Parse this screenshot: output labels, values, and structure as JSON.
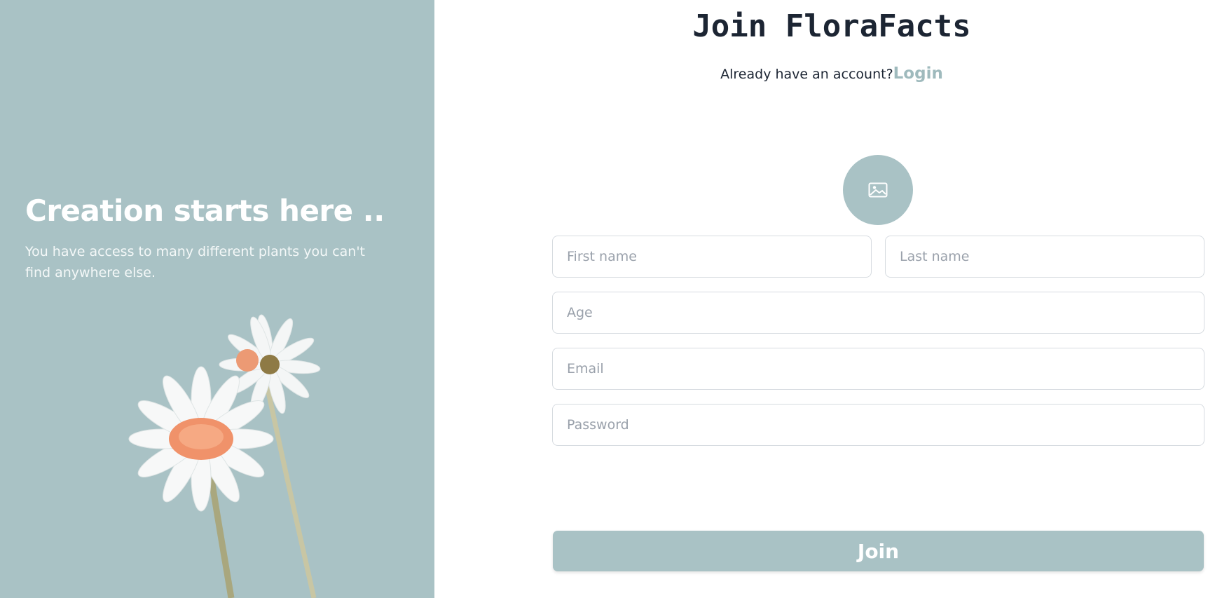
{
  "hero": {
    "title": "Creation starts here ..",
    "subtitle": "You have access to many different plants you can't find anywhere else."
  },
  "form": {
    "title": "Join FloraFacts",
    "login_prompt": "Already have an account?",
    "login_link": "Login",
    "avatar_icon": "image-icon",
    "first_name_placeholder": "First name",
    "last_name_placeholder": "Last name",
    "age_placeholder": "Age",
    "email_placeholder": "Email",
    "password_placeholder": "Password",
    "submit_label": "Join"
  },
  "colors": {
    "accent": "#a9c2c5",
    "title_text": "#1c2533",
    "link": "#9fbabd",
    "placeholder": "#9aa1ab"
  }
}
